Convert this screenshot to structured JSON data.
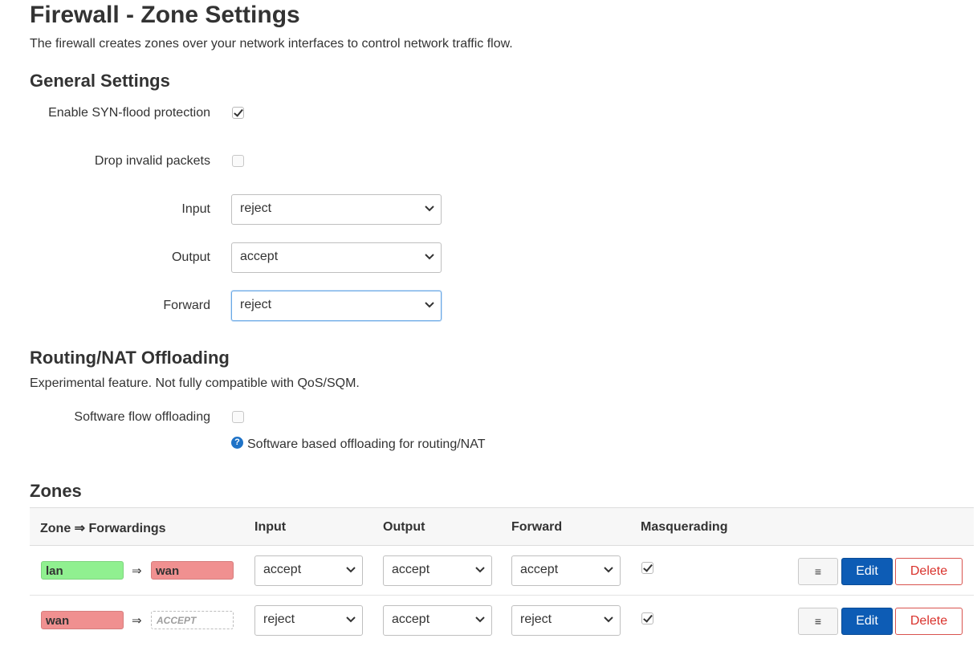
{
  "page": {
    "title": "Firewall - Zone Settings",
    "description": "The firewall creates zones over your network interfaces to control network traffic flow."
  },
  "general": {
    "heading": "General Settings",
    "syn_flood_label": "Enable SYN-flood protection",
    "syn_flood_checked": true,
    "drop_invalid_label": "Drop invalid packets",
    "drop_invalid_checked": false,
    "input_label": "Input",
    "input_value": "reject",
    "output_label": "Output",
    "output_value": "accept",
    "forward_label": "Forward",
    "forward_value": "reject"
  },
  "offloading": {
    "heading": "Routing/NAT Offloading",
    "description": "Experimental feature. Not fully compatible with QoS/SQM.",
    "sw_flow_label": "Software flow offloading",
    "sw_flow_checked": false,
    "help_text": "Software based offloading for routing/NAT",
    "help_icon": "?"
  },
  "zones": {
    "heading": "Zones",
    "columns": [
      "Zone ⇒ Forwardings",
      "Input",
      "Output",
      "Forward",
      "Masquerading"
    ],
    "arrow": "⇒",
    "menu_label": "≡",
    "edit_label": "Edit",
    "delete_label": "Delete",
    "rows": [
      {
        "zone": "lan",
        "zone_color": "#90f090",
        "forward_to": "wan",
        "forward_color": "#f09090",
        "input": "accept",
        "output": "accept",
        "forward": "accept",
        "masquerading": true
      },
      {
        "zone": "wan",
        "zone_color": "#f09090",
        "forward_to": "ACCEPT",
        "forward_color": "#ffffff",
        "input": "reject",
        "output": "accept",
        "forward": "reject",
        "masquerading": true
      }
    ]
  },
  "colors": {
    "edit_button": "#0d5cb5",
    "delete_text": "#d9322c",
    "help_icon": "#1f73c7",
    "focus_border": "#69a8e6"
  }
}
